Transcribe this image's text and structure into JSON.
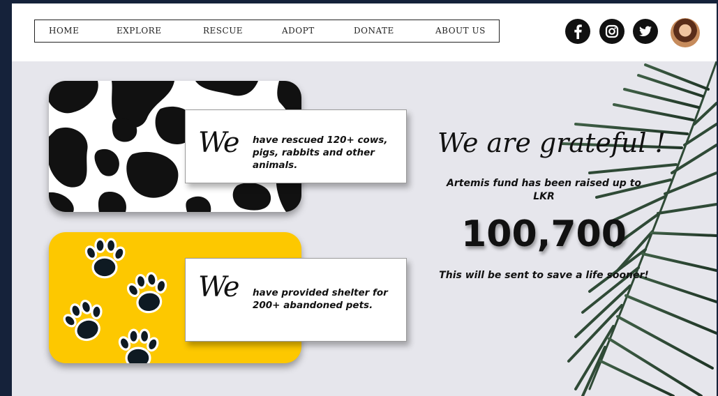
{
  "nav": {
    "items": [
      "HOME",
      "EXPLORE",
      "RESCUE",
      "ADOPT",
      "DONATE",
      "ABOUT US"
    ]
  },
  "social": {
    "icons": [
      "facebook-icon",
      "instagram-icon",
      "twitter-icon"
    ],
    "profile": "avatar"
  },
  "colors": {
    "page_bg": "#e6e6ec",
    "frame_bg": "#15223a",
    "accent_yellow": "#fdc800",
    "text": "#111111"
  },
  "cards": [
    {
      "pattern": "cow-print",
      "we": "We",
      "text": "have rescued 120+ cows, pigs, rabbits and other animals."
    },
    {
      "pattern": "paw-prints",
      "we": "We",
      "text": "have provided shelter for 200+ abandoned pets."
    }
  ],
  "hero": {
    "title": "We are grateful !",
    "fund_text": "Artemis fund has been raised up to LKR",
    "amount": "100,700",
    "note": "This will be sent to save a life sooner!"
  }
}
